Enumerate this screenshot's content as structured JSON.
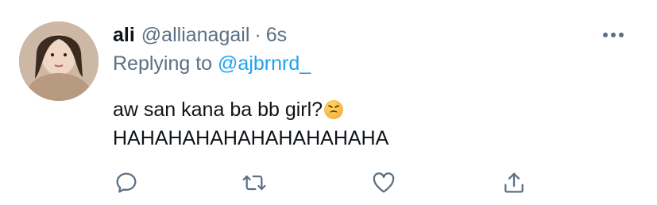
{
  "tweet": {
    "display_name": "ali",
    "handle": "@allianagail",
    "separator": "·",
    "time": "6s",
    "replying_prefix": "Replying to",
    "replying_to": "@ajbrnrd_",
    "text_line1": "aw san kana ba bb girl?",
    "emoji": "confounded-face",
    "text_line2": "HAHAHAHAHAHAHAHAHAHA"
  },
  "actions": [
    {
      "name": "reply",
      "icon": "reply-icon"
    },
    {
      "name": "retweet",
      "icon": "retweet-icon"
    },
    {
      "name": "like",
      "icon": "heart-icon"
    },
    {
      "name": "share",
      "icon": "share-icon"
    }
  ],
  "colors": {
    "text": "#0f1419",
    "secondary": "#5b7083",
    "link": "#1da1f2",
    "background": "#ffffff"
  }
}
